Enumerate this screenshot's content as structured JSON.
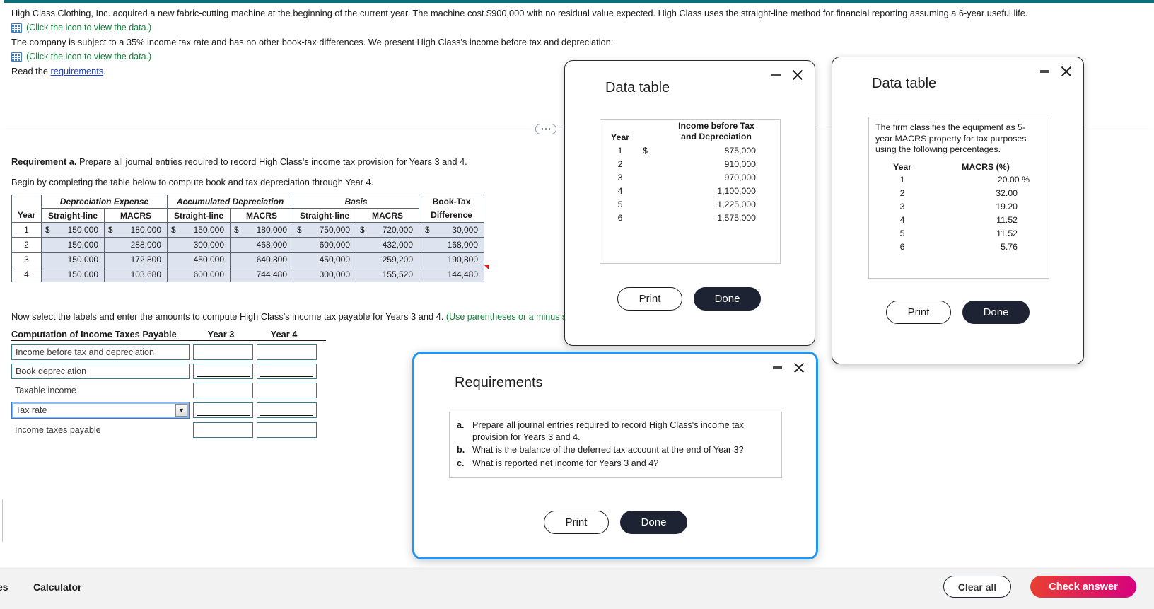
{
  "stem": {
    "para1": "High Class Clothing, Inc. acquired a new fabric-cutting machine at the beginning of the current year. The machine cost $900,000 with no residual value expected. High Class uses the straight-line method for financial reporting assuming a 6-year useful life.",
    "icon_hint1": "(Click the icon to view the data.)",
    "para2": "The company is subject to a 35% income tax rate and has no other book-tax differences. We present High Class's income before tax and depreciation:",
    "icon_hint2": "(Click the icon to view the data.)",
    "read_prefix": "Read the ",
    "read_link": "requirements",
    "read_suffix": "."
  },
  "requirement": {
    "label": "Requirement a.",
    "text": " Prepare all journal entries required to record High Class's income tax provision for Years 3 and 4.",
    "begin": "Begin by completing the table below to compute book and tax depreciation through Year 4."
  },
  "dep_table": {
    "groups": [
      "Depreciation Expense",
      "Accumulated Depreciation",
      "Basis",
      "Book-Tax"
    ],
    "sub": [
      "Year",
      "Straight-line",
      "MACRS",
      "Straight-line",
      "MACRS",
      "Straight-line",
      "MACRS",
      "Difference"
    ],
    "rows": [
      {
        "year": "1",
        "de_sl": "150,000",
        "de_mac": "180,000",
        "ad_sl": "150,000",
        "ad_mac": "180,000",
        "b_sl": "750,000",
        "b_mac": "720,000",
        "diff": "30,000",
        "dollar": "$"
      },
      {
        "year": "2",
        "de_sl": "150,000",
        "de_mac": "288,000",
        "ad_sl": "300,000",
        "ad_mac": "468,000",
        "b_sl": "600,000",
        "b_mac": "432,000",
        "diff": "168,000",
        "dollar": ""
      },
      {
        "year": "3",
        "de_sl": "150,000",
        "de_mac": "172,800",
        "ad_sl": "450,000",
        "ad_mac": "640,800",
        "b_sl": "450,000",
        "b_mac": "259,200",
        "diff": "190,800",
        "dollar": ""
      },
      {
        "year": "4",
        "de_sl": "150,000",
        "de_mac": "103,680",
        "ad_sl": "600,000",
        "ad_mac": "744,480",
        "b_sl": "300,000",
        "b_mac": "155,520",
        "diff": "144,480",
        "dollar": ""
      }
    ]
  },
  "now_select": {
    "black": "Now select the labels and enter the amounts to compute High Class's income tax payable for Years 3 and 4. ",
    "green": "(Use parentheses or a minus sig"
  },
  "computation": {
    "title": "Computation of Income Taxes Payable",
    "col_year3": "Year 3",
    "col_year4": "Year 4",
    "rows": [
      {
        "label": "Income before tax and depreciation",
        "kind": "box",
        "ruled": false
      },
      {
        "label": "Book depreciation",
        "kind": "box",
        "ruled": true
      },
      {
        "label": "Taxable income",
        "kind": "plain",
        "ruled": false
      },
      {
        "label": "Tax rate",
        "kind": "select",
        "ruled": true
      },
      {
        "label": "Income taxes payable",
        "kind": "plain",
        "ruled": false
      }
    ],
    "year3_values": [
      "",
      "",
      "",
      "",
      ""
    ],
    "year4_values": [
      "",
      "",
      "",
      "",
      ""
    ]
  },
  "dialog_income": {
    "title": "Data table",
    "header_line1": "Income before Tax",
    "header_year": "Year",
    "header_line2": "and Depreciation",
    "rows": [
      {
        "year": "1",
        "dollar": "$",
        "value": "875,000"
      },
      {
        "year": "2",
        "dollar": "",
        "value": "910,000"
      },
      {
        "year": "3",
        "dollar": "",
        "value": "970,000"
      },
      {
        "year": "4",
        "dollar": "",
        "value": "1,100,000"
      },
      {
        "year": "5",
        "dollar": "",
        "value": "1,225,000"
      },
      {
        "year": "6",
        "dollar": "",
        "value": "1,575,000"
      }
    ],
    "print_label": "Print",
    "done_label": "Done"
  },
  "dialog_macrs": {
    "title": "Data table",
    "intro": "The firm classifies the equipment as 5-year MACRS property for tax purposes using the following percentages.",
    "col_year": "Year",
    "col_pct": "MACRS (%)",
    "rows": [
      {
        "year": "1",
        "pct": "20.00 %"
      },
      {
        "year": "2",
        "pct": "32.00"
      },
      {
        "year": "3",
        "pct": "19.20"
      },
      {
        "year": "4",
        "pct": "11.52"
      },
      {
        "year": "5",
        "pct": "11.52"
      },
      {
        "year": "6",
        "pct": "5.76"
      }
    ],
    "print_label": "Print",
    "done_label": "Done"
  },
  "dialog_requirements": {
    "title": "Requirements",
    "items": [
      {
        "mark": "a.",
        "text": "Prepare all journal entries required to record High Class's income tax provision for Years 3 and 4."
      },
      {
        "mark": "b.",
        "text": "What is the balance of the deferred tax account at the end of Year 3?"
      },
      {
        "mark": "c.",
        "text": "What is reported net income for Years 3 and 4?"
      }
    ],
    "print_label": "Print",
    "done_label": "Done"
  },
  "footer": {
    "left_truncated": "es",
    "calculator": "Calculator",
    "clear_all": "Clear all",
    "check_answer": "Check answer"
  },
  "colors": {
    "accent_teal": "#0a6f7a",
    "link_blue": "#2244cc",
    "hint_green": "#17803d",
    "table_fill": "#dde3ef",
    "focus_blue": "#2196f3",
    "check_gradient_start": "#e8412f",
    "check_gradient_end": "#d6007f"
  }
}
